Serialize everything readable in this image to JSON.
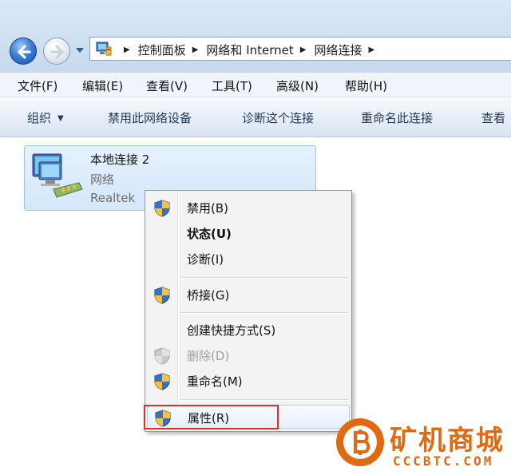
{
  "breadcrumb": [
    "控制面板",
    "网络和 Internet",
    "网络连接"
  ],
  "menu": [
    "文件(F)",
    "编辑(E)",
    "查看(V)",
    "工具(T)",
    "高级(N)",
    "帮助(H)"
  ],
  "commands": [
    "组织",
    "禁用此网络设备",
    "诊断这个连接",
    "重命名此连接",
    "查看"
  ],
  "adapter": {
    "name": "本地连接 2",
    "type": "网络",
    "device": "Realtek"
  },
  "context_menu": [
    {
      "label": "禁用(B)",
      "shield": true
    },
    {
      "label": "状态(U)",
      "bold": true
    },
    {
      "label": "诊断(I)"
    },
    {
      "label": "桥接(G)",
      "shield": true
    },
    {
      "label": "创建快捷方式(S)"
    },
    {
      "label": "删除(D)",
      "shield": true,
      "disabled": true
    },
    {
      "label": "重命名(M)",
      "shield": true
    },
    {
      "label": "属性(R)",
      "shield": true,
      "highlighted": true
    }
  ],
  "watermark": {
    "text": "矿机商城",
    "sub": "CCCBTC.COM"
  },
  "colors": {
    "highlight_box": "#d8302f",
    "watermark": "#e06a10"
  }
}
